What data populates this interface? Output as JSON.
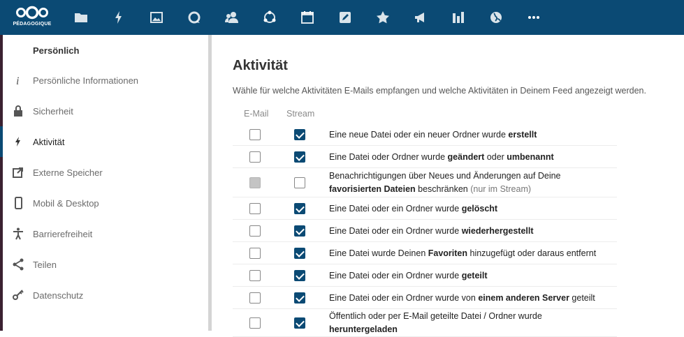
{
  "header": {
    "logo_text": "PÉDAGOGIQUE",
    "nav_icons": [
      "files-icon",
      "activity-icon",
      "photos-icon",
      "talk-icon",
      "contacts-icon",
      "circles-icon",
      "calendar-icon",
      "notes-icon",
      "favorites-icon",
      "announcements-icon",
      "analytics-icon",
      "web-icon",
      "more-icon"
    ]
  },
  "sidebar": {
    "header": "Persönlich",
    "items": [
      {
        "label": "Persönliche Informationen",
        "icon": "info-icon"
      },
      {
        "label": "Sicherheit",
        "icon": "lock-icon"
      },
      {
        "label": "Aktivität",
        "icon": "activity-icon"
      },
      {
        "label": "Externe Speicher",
        "icon": "external-storage-icon"
      },
      {
        "label": "Mobil & Desktop",
        "icon": "mobile-icon"
      },
      {
        "label": "Barrierefreiheit",
        "icon": "accessibility-icon"
      },
      {
        "label": "Teilen",
        "icon": "share-icon"
      },
      {
        "label": "Datenschutz",
        "icon": "privacy-key-icon"
      }
    ],
    "active_index": 2
  },
  "main": {
    "title": "Aktivität",
    "description": "Wähle für welche Aktivitäten E-Mails empfangen und welche Aktivitäten in Deinem Feed angezeigt werden.",
    "col_email": "E-Mail",
    "col_stream": "Stream",
    "rows": [
      {
        "email": "unchecked",
        "stream": "checked",
        "parts": [
          [
            "Eine neue Datei oder ein neuer Ordner wurde ",
            "n"
          ],
          [
            "erstellt",
            "b"
          ]
        ]
      },
      {
        "email": "unchecked",
        "stream": "checked",
        "parts": [
          [
            "Eine Datei oder Ordner wurde ",
            "n"
          ],
          [
            "geändert",
            "b"
          ],
          [
            " oder ",
            "n"
          ],
          [
            "umbenannt",
            "b"
          ]
        ]
      },
      {
        "email": "disabled",
        "stream": "unchecked",
        "parts": [
          [
            "Benachrichtigungen über Neues und Änderungen auf Deine",
            "n"
          ],
          [
            "\n",
            "br"
          ],
          [
            "favorisierten Dateien",
            "b"
          ],
          [
            " beschränken ",
            "n"
          ],
          [
            "(nur im Stream)",
            "m"
          ]
        ]
      },
      {
        "email": "unchecked",
        "stream": "checked",
        "parts": [
          [
            "Eine Datei oder ein Ordner wurde ",
            "n"
          ],
          [
            "gelöscht",
            "b"
          ]
        ]
      },
      {
        "email": "unchecked",
        "stream": "checked",
        "parts": [
          [
            "Eine Datei oder ein Ordner wurde ",
            "n"
          ],
          [
            "wiederhergestellt",
            "b"
          ]
        ]
      },
      {
        "email": "unchecked",
        "stream": "checked",
        "parts": [
          [
            "Eine Datei wurde Deinen ",
            "n"
          ],
          [
            "Favoriten",
            "b"
          ],
          [
            " hinzugefügt oder daraus entfernt",
            "n"
          ]
        ]
      },
      {
        "email": "unchecked",
        "stream": "checked",
        "parts": [
          [
            "Eine Datei oder ein Ordner wurde ",
            "n"
          ],
          [
            "geteilt",
            "b"
          ]
        ]
      },
      {
        "email": "unchecked",
        "stream": "checked",
        "parts": [
          [
            "Eine Datei oder ein Ordner wurde von ",
            "n"
          ],
          [
            "einem anderen Server",
            "b"
          ],
          [
            " geteilt",
            "n"
          ]
        ]
      },
      {
        "email": "unchecked",
        "stream": "checked",
        "parts": [
          [
            "Öffentlich oder per E-Mail geteilte Datei / Ordner wurde",
            "n"
          ],
          [
            "\n",
            "br"
          ],
          [
            "heruntergeladen",
            "b"
          ]
        ]
      }
    ]
  },
  "colors": {
    "header_bg": "#0b4a74",
    "accent": "#0b4a74"
  }
}
